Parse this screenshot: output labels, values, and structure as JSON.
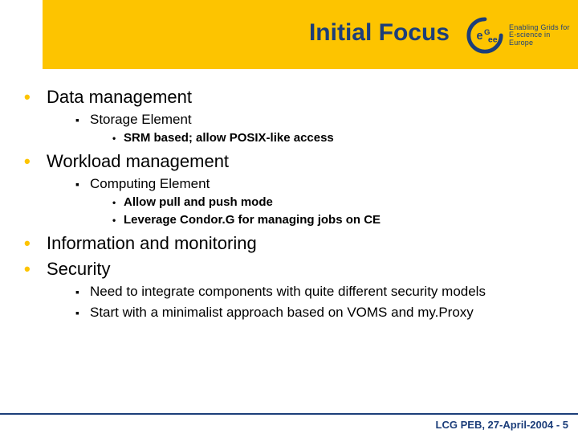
{
  "header": {
    "title": "Initial Focus",
    "logo": {
      "name": "eGee",
      "tagline1": "Enabling Grids for",
      "tagline2": "E-science in Europe"
    }
  },
  "bullets": [
    {
      "text": "Data management",
      "children": [
        {
          "text": "Storage Element",
          "children": [
            {
              "text": "SRM based; allow POSIX-like access"
            }
          ]
        }
      ]
    },
    {
      "text": "Workload management",
      "children": [
        {
          "text": "Computing Element",
          "children": [
            {
              "text": "Allow pull and push mode"
            },
            {
              "text": "Leverage Condor.G for managing jobs on CE"
            }
          ]
        }
      ]
    },
    {
      "text": "Information and monitoring",
      "children": []
    },
    {
      "text": "Security",
      "children": [
        {
          "text": "Need to integrate components with quite different security models",
          "children": []
        },
        {
          "text": "Start with a minimalist approach based on VOMS and my.Proxy",
          "children": []
        }
      ]
    }
  ],
  "footer": "LCG PEB, 27-April-2004 - 5"
}
